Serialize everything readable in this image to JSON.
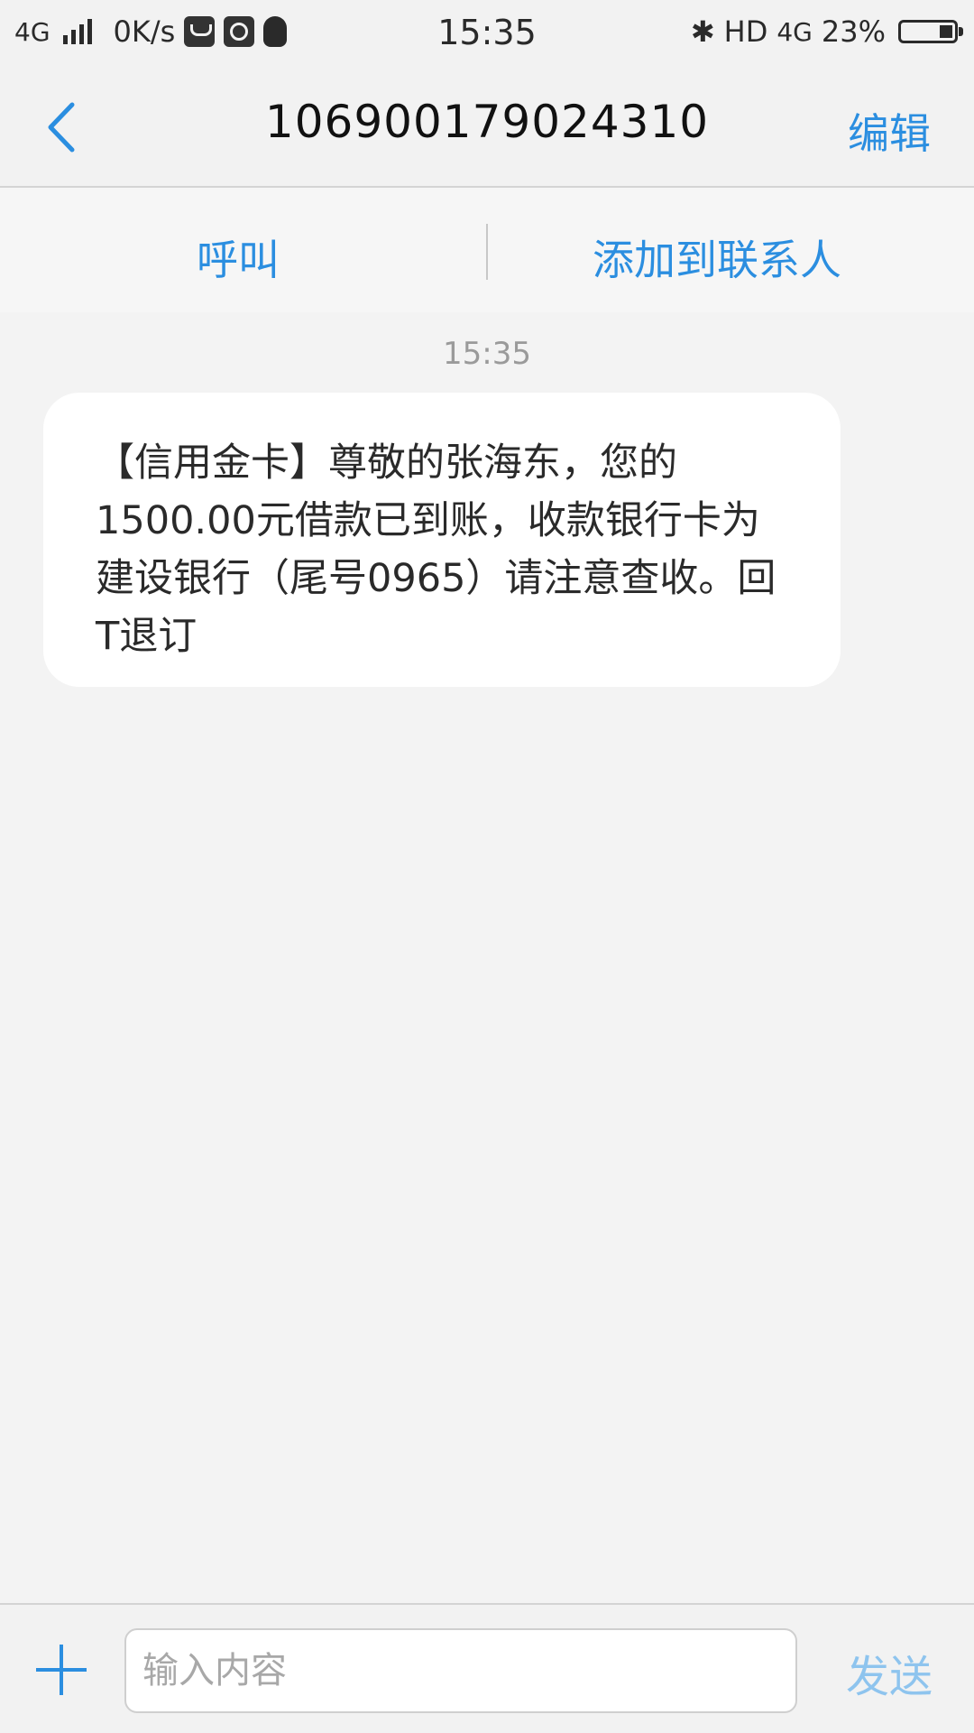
{
  "status_bar": {
    "network_left": "4G",
    "speed": "0K/s",
    "time": "15:35",
    "hd": "HD",
    "network_right": "4G",
    "battery": "23%",
    "icons": [
      "signal-icon",
      "message-app-icon",
      "dial-app-icon",
      "qq-icon",
      "bluetooth-icon",
      "battery-icon"
    ]
  },
  "header": {
    "title": "106900179024310",
    "edit_label": "编辑",
    "back_icon": "chevron-left-icon"
  },
  "actions": {
    "call_label": "呼叫",
    "add_contact_label": "添加到联系人"
  },
  "conversation": {
    "timestamp": "15:35",
    "messages": [
      {
        "text": "【信用金卡】尊敬的张海东，您的1500.00元借款已到账，收款银行卡为建设银行（尾号0965）请注意查收。回T退订"
      }
    ]
  },
  "composer": {
    "placeholder": "输入内容",
    "value": "",
    "send_label": "发送",
    "plus_icon": "plus-icon"
  },
  "colors": {
    "accent": "#2b8ee0",
    "send_disabled": "#8ec4ee",
    "background": "#f3f3f3",
    "bubble": "#ffffff"
  }
}
